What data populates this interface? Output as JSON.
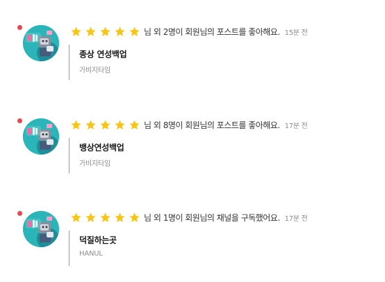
{
  "colors": {
    "unread_dot": "#e5484d",
    "star": "#f5c518",
    "avatar_bg": "#2bb5b8"
  },
  "icons": {
    "unread": "unread-dot-icon",
    "star": "star-icon",
    "avatar": "avatar-image"
  },
  "notifications": [
    {
      "rating": 5,
      "message": "님 외 2명이 회원님의 포스트를 좋아해요.",
      "time": "15분 전",
      "post_title": "종상 연성백업",
      "post_author": "가비지타임"
    },
    {
      "rating": 5,
      "message": "님 외 8명이 회원님의 포스트를 좋아해요.",
      "time": "17분 전",
      "post_title": "뱅상연성백업",
      "post_author": "가비지타임"
    },
    {
      "rating": 5,
      "message": "님 외 1명이 회원님의 채널을 구독했어요.",
      "time": "17분 전",
      "post_title": "덕질하는곳",
      "post_author": "HANUL"
    }
  ]
}
